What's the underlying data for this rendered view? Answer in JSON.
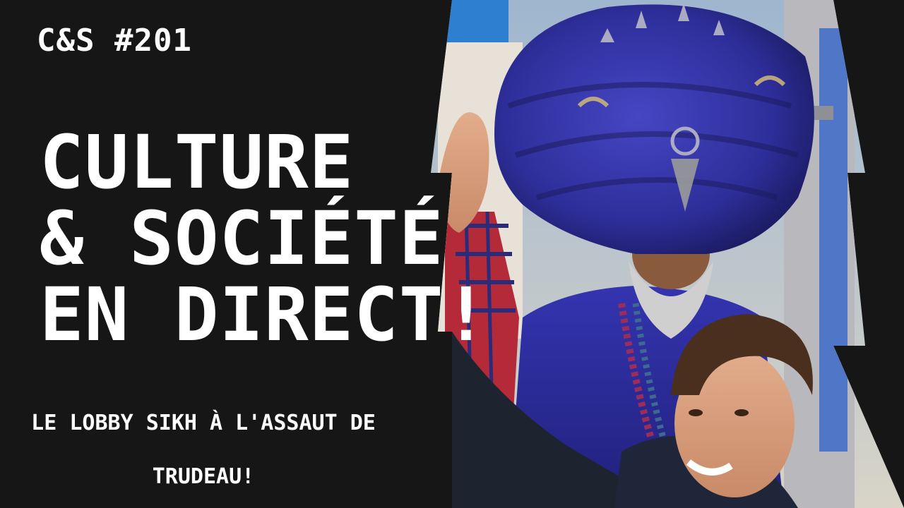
{
  "episode": "C&S #201",
  "headline": {
    "line1": "CULTURE",
    "line2": "& SOCIÉTÉ",
    "line3": "EN DIRECT!"
  },
  "subtitle": "LE LOBBY SIKH À L'ASSAUT DE TRUDEAU!",
  "colors": {
    "background": "#161616",
    "text": "#ffffff",
    "turban_blue": "#2f2f9e"
  },
  "image": {
    "subject": "photo of a man in a large blue turban with a smiling waving man in the foreground"
  }
}
